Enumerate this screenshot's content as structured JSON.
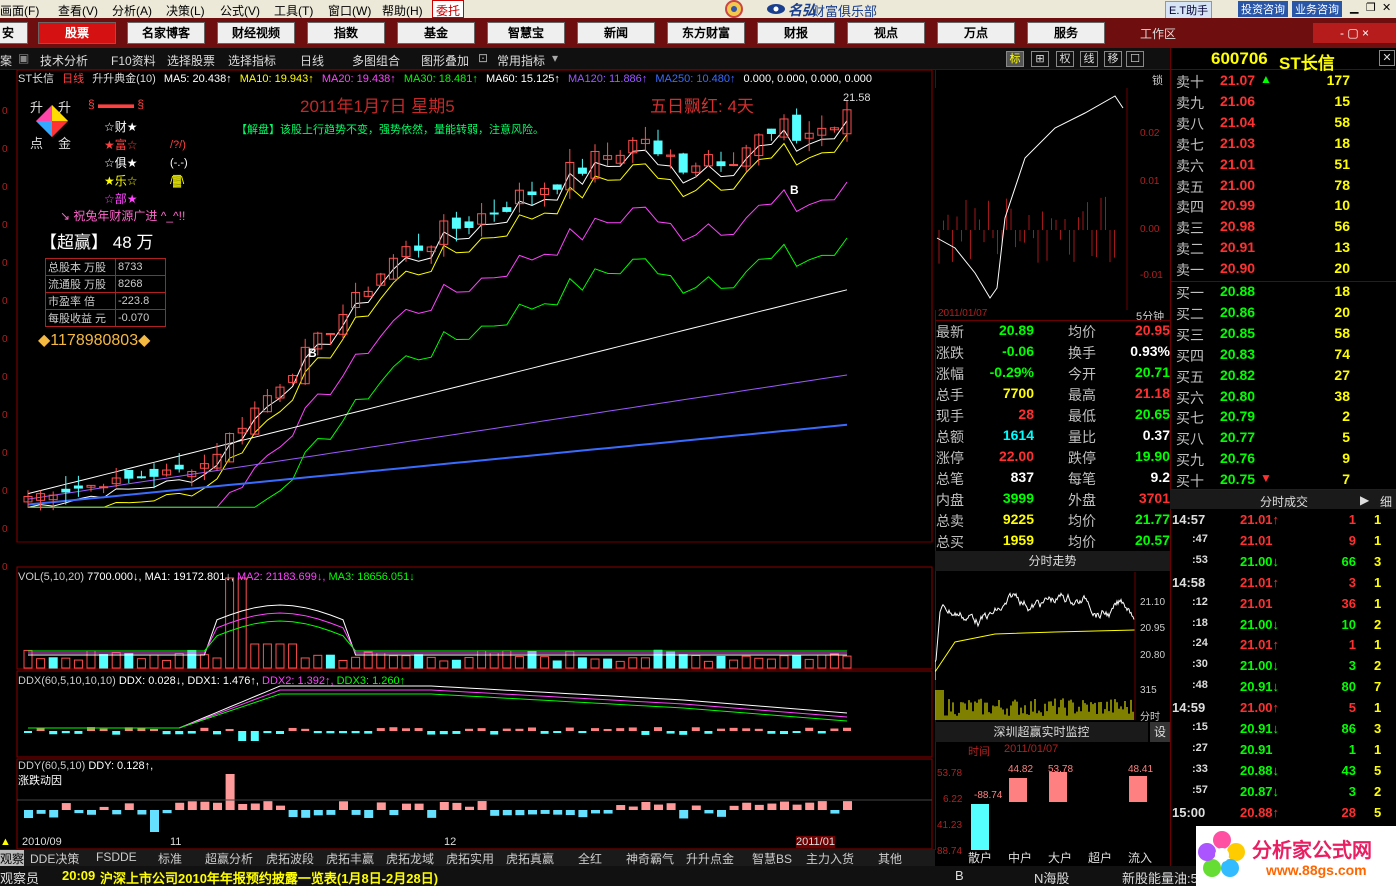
{
  "menubar": {
    "items": [
      "画面(F)",
      "查看(V)",
      "分析(A)",
      "决策(L)",
      "公式(V)",
      "工具(T)",
      "窗口(W)",
      "帮助(H)"
    ],
    "trade_label": "委托",
    "brand": "财富俱乐部",
    "assistant_label": "E.T助手",
    "btn_invest": "投资咨询",
    "btn_business": "业务咨询"
  },
  "mainbar": {
    "tabs": [
      "股票",
      "名家博客",
      "财经视频",
      "指数",
      "基金",
      "智慧宝",
      "新闻",
      "东方财富",
      "财报",
      "视点",
      "万点",
      "服务"
    ],
    "workspace": "工作区",
    "window_controls": "- ▢ ×"
  },
  "toolbar": {
    "items": [
      "技术分析",
      "F10资料",
      "选择股票",
      "选择指标",
      "日线",
      "多图组合",
      "图形叠加",
      "常用指标"
    ],
    "icons": [
      "标",
      "⊞",
      "权",
      "线",
      "移",
      "☐"
    ],
    "left_stub": "案"
  },
  "chart_header": {
    "stock": "ST长信",
    "period": "日线",
    "indicator": "升升典金(10)",
    "ma": [
      {
        "label": "MA5: 20.438↑",
        "color": "#ffffff"
      },
      {
        "label": "MA10: 19.943↑",
        "color": "#ffff00"
      },
      {
        "label": "MA20: 19.438↑",
        "color": "#ff44ff"
      },
      {
        "label": "MA30: 18.481↑",
        "color": "#00ff00"
      },
      {
        "label": "MA60: 15.125↑",
        "color": "#ffffff"
      },
      {
        "label": "MA120: 11.886↑",
        "color": "#9b59ff"
      },
      {
        "label": "MA250: 10.480↑",
        "color": "#3a6bff"
      },
      {
        "label": "0.000, 0.000, 0.000, 0.000",
        "color": "#ffffff"
      }
    ]
  },
  "annotations": {
    "date_text": "2011年1月7日 星期5",
    "streak_text": "五日飘红: 4天",
    "advice": "【解盘】该股上行趋势不变，强势依然，量能转弱，注意风险。",
    "peak_label": "21.58",
    "rise_logo": [
      "升",
      "升",
      "点",
      "金"
    ],
    "legend_items": [
      {
        "text": "☆财★",
        "color": "#ffffff"
      },
      {
        "text": "★富☆",
        "color": "#ff4040"
      },
      {
        "text": "☆俱★",
        "color": "#ffffff"
      },
      {
        "text": "★乐☆",
        "color": "#ffff00"
      },
      {
        "text": "☆部★",
        "color": "#ff44ff"
      }
    ],
    "legend_vals": [
      "/?/)",
      "(-.-)",
      "/▓\\"
    ],
    "greeting": "↘ 祝兔年财源广进 ^_^!!",
    "super_label": "【超赢】",
    "super_value": "48",
    "super_unit": "万",
    "share_table": [
      {
        "k": "总股本 万股",
        "v": "8733"
      },
      {
        "k": "流通股 万股",
        "v": "8268"
      },
      {
        "k": "市盈率  倍",
        "v": "-223.8"
      },
      {
        "k": "每股收益 元",
        "v": "-0.070"
      }
    ],
    "phone": "◆1178980803◆",
    "b_markers": [
      "B",
      "B"
    ]
  },
  "y_axis_stubs": [
    "0",
    "0",
    "0",
    "0",
    "0",
    "0",
    "0",
    "0",
    "0",
    "0",
    "0",
    "0",
    "0"
  ],
  "vol_header": {
    "title": "VOL(5,10,20)",
    "vol": "7700.000↓,",
    "ma1": "MA1: 19172.801↓,",
    "ma2": "MA2: 21183.699↓,",
    "ma3": "MA3: 18656.051↓"
  },
  "ddx_header": {
    "title": "DDX(60,5,10,10,10)",
    "ddx": "DDX: 0.028↓,",
    "ddx1": "DDX1: 1.476↑,",
    "ddx2": "DDX2: 1.392↑,",
    "ddx3": "DDX3: 1.260↑"
  },
  "ddy_header": {
    "title": "DDY(60,5,10)",
    "ddy": "DDY: 0.128↑,",
    "sub": "涨跌动因"
  },
  "x_axis_dates": [
    "2010/09",
    "11",
    "12",
    "2011/01"
  ],
  "bottom_tabs": [
    "观察",
    "DDE决策",
    "FSDDE",
    "标准",
    "超赢分析",
    "虎拓波段",
    "虎拓丰赢",
    "虎拓龙域",
    "虎拓实用",
    "虎拓真赢",
    "全红",
    "神奇霸气",
    "升升点金",
    "智慧BS",
    "主力入货",
    "其他"
  ],
  "ticker": {
    "left": "观察员",
    "time": "20:09",
    "news": "沪深上市公司2010年年报预约披露一览表(1月8日-2月28日)",
    "idx1": "B",
    "idx2": "N海股",
    "idx3": "新股能量油:5",
    "site": "分析家公式网",
    "url": "www.88gs.com"
  },
  "side": {
    "lock": "锁",
    "mini_date": "2011/01/07",
    "mini_period": "5分钟",
    "mini_axis": [
      "0.02",
      "0.01",
      "0.00",
      "-0.01"
    ],
    "fst_title": "分时走势",
    "fst_axis": [
      "21.10",
      "20.95",
      "20.80"
    ],
    "fst_vol": "315",
    "fst_label": "分时",
    "monitor_title": "深圳超赢实时监控",
    "monitor_setting": "设",
    "monitor_date_label": "时间",
    "monitor_date": "2011/01/07",
    "monitor_axis": [
      "53.78",
      "6.22",
      "41.23",
      "88.74"
    ],
    "monitor_bars": [
      {
        "label": "散户",
        "value": "-88.74"
      },
      {
        "label": "中户",
        "value": "44.82"
      },
      {
        "label": "大户",
        "value": "53.78"
      },
      {
        "label": "超户",
        "value": ""
      },
      {
        "label": "流入",
        "value": "48.41"
      }
    ]
  },
  "quote": {
    "code": "600706",
    "name": "ST长信",
    "asks": [
      {
        "label": "卖十",
        "price": "21.07",
        "vol": "177",
        "arrow": "▲"
      },
      {
        "label": "卖九",
        "price": "21.06",
        "vol": "15"
      },
      {
        "label": "卖八",
        "price": "21.04",
        "vol": "58"
      },
      {
        "label": "卖七",
        "price": "21.03",
        "vol": "18"
      },
      {
        "label": "卖六",
        "price": "21.01",
        "vol": "51"
      },
      {
        "label": "卖五",
        "price": "21.00",
        "vol": "78"
      },
      {
        "label": "卖四",
        "price": "20.99",
        "vol": "10"
      },
      {
        "label": "卖三",
        "price": "20.98",
        "vol": "56"
      },
      {
        "label": "卖二",
        "price": "20.91",
        "vol": "13"
      },
      {
        "label": "卖一",
        "price": "20.90",
        "vol": "20"
      }
    ],
    "bids": [
      {
        "label": "买一",
        "price": "20.88",
        "vol": "18"
      },
      {
        "label": "买二",
        "price": "20.86",
        "vol": "20"
      },
      {
        "label": "买三",
        "price": "20.85",
        "vol": "58"
      },
      {
        "label": "买四",
        "price": "20.83",
        "vol": "74"
      },
      {
        "label": "买五",
        "price": "20.82",
        "vol": "27"
      },
      {
        "label": "买六",
        "price": "20.80",
        "vol": "38"
      },
      {
        "label": "买七",
        "price": "20.79",
        "vol": "2"
      },
      {
        "label": "买八",
        "price": "20.77",
        "vol": "5"
      },
      {
        "label": "买九",
        "price": "20.76",
        "vol": "9"
      },
      {
        "label": "买十",
        "price": "20.75",
        "vol": "7",
        "arrow": "▼"
      }
    ],
    "stats": [
      {
        "l": "最新",
        "v": "20.89",
        "vc": "#00ff00",
        "l2": "均价",
        "v2": "20.95",
        "v2c": "#ff3030"
      },
      {
        "l": "涨跌",
        "v": "-0.06",
        "vc": "#00ff00",
        "l2": "换手",
        "v2": "0.93%",
        "v2c": "#ffffff"
      },
      {
        "l": "涨幅",
        "v": "-0.29%",
        "vc": "#00ff00",
        "l2": "今开",
        "v2": "20.71",
        "v2c": "#00ff00"
      },
      {
        "l": "总手",
        "v": "7700",
        "vc": "#ffff00",
        "l2": "最高",
        "v2": "21.18",
        "v2c": "#ff3030"
      },
      {
        "l": "现手",
        "v": "28",
        "vc": "#ff3030",
        "l2": "最低",
        "v2": "20.65",
        "v2c": "#00ff00"
      },
      {
        "l": "总额",
        "v": "1614",
        "vc": "#00ffff",
        "l2": "量比",
        "v2": "0.37",
        "v2c": "#ffffff"
      },
      {
        "l": "涨停",
        "v": "22.00",
        "vc": "#ff3030",
        "l2": "跌停",
        "v2": "19.90",
        "v2c": "#00ff00"
      },
      {
        "l": "总笔",
        "v": "837",
        "vc": "#ffffff",
        "l2": "每笔",
        "v2": "9.2",
        "v2c": "#ffffff"
      },
      {
        "l": "内盘",
        "v": "3999",
        "vc": "#00ff00",
        "l2": "外盘",
        "v2": "3701",
        "v2c": "#ff3030"
      },
      {
        "l": "总卖",
        "v": "9225",
        "vc": "#ffff00",
        "l2": "均价",
        "v2": "21.77",
        "v2c": "#00ff00"
      },
      {
        "l": "总买",
        "v": "1959",
        "vc": "#ffff00",
        "l2": "均价",
        "v2": "20.57",
        "v2c": "#00ff00"
      }
    ],
    "tick_title": "分时成交",
    "tick_side": "细",
    "ticks": [
      {
        "t": "14:57",
        "p": "21.01",
        "a": "↑",
        "v": "1",
        "d": "1",
        "c": "#ff3030"
      },
      {
        "t": ":47",
        "p": "21.01",
        "a": "",
        "v": "9",
        "d": "1",
        "c": "#ff3030"
      },
      {
        "t": ":53",
        "p": "21.00",
        "a": "↓",
        "v": "66",
        "d": "3",
        "c": "#00ff00"
      },
      {
        "t": "14:58",
        "p": "21.01",
        "a": "↑",
        "v": "3",
        "d": "1",
        "c": "#ff3030"
      },
      {
        "t": ":12",
        "p": "21.01",
        "a": "",
        "v": "36",
        "d": "1",
        "c": "#ff3030"
      },
      {
        "t": ":18",
        "p": "21.00",
        "a": "↓",
        "v": "10",
        "d": "2",
        "c": "#00ff00"
      },
      {
        "t": ":24",
        "p": "21.01",
        "a": "↑",
        "v": "1",
        "d": "1",
        "c": "#ff3030"
      },
      {
        "t": ":30",
        "p": "21.00",
        "a": "↓",
        "v": "3",
        "d": "2",
        "c": "#00ff00"
      },
      {
        "t": ":48",
        "p": "20.91",
        "a": "↓",
        "v": "80",
        "d": "7",
        "c": "#00ff00"
      },
      {
        "t": "14:59",
        "p": "21.00",
        "a": "↑",
        "v": "5",
        "d": "1",
        "c": "#ff3030"
      },
      {
        "t": ":15",
        "p": "20.91",
        "a": "↓",
        "v": "86",
        "d": "3",
        "c": "#00ff00"
      },
      {
        "t": ":27",
        "p": "20.91",
        "a": "",
        "v": "1",
        "d": "1",
        "c": "#00ff00"
      },
      {
        "t": ":33",
        "p": "20.88",
        "a": "↓",
        "v": "43",
        "d": "5",
        "c": "#00ff00"
      },
      {
        "t": ":57",
        "p": "20.87",
        "a": "↓",
        "v": "3",
        "d": "2",
        "c": "#00ff00"
      },
      {
        "t": "15:00",
        "p": "20.88",
        "a": "↑",
        "v": "28",
        "d": "5",
        "c": "#ff3030"
      }
    ]
  }
}
